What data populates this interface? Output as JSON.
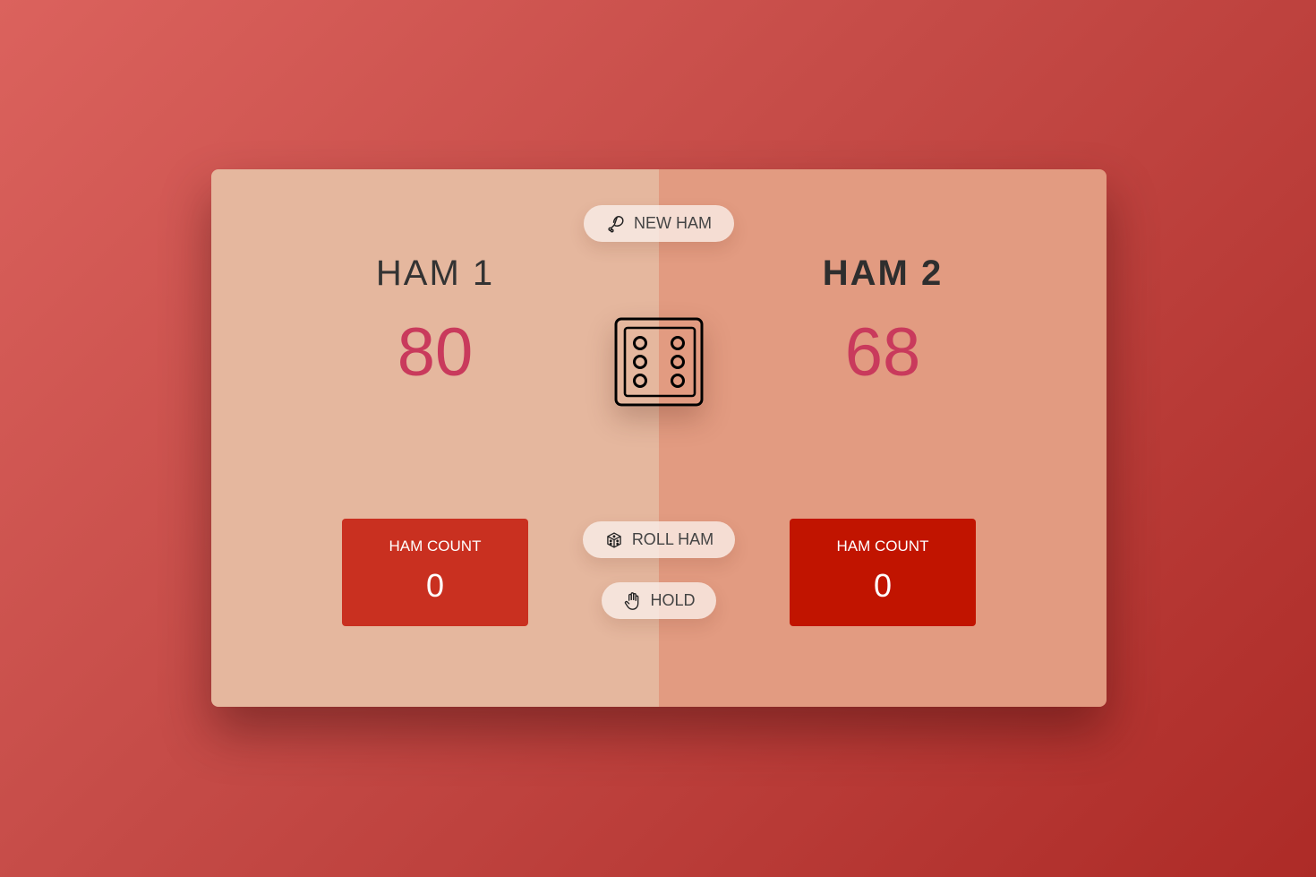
{
  "players": [
    {
      "name": "HAM 1",
      "score": "80",
      "current_label": "HAM COUNT",
      "current_score": "0"
    },
    {
      "name": "HAM 2",
      "score": "68",
      "current_label": "HAM COUNT",
      "current_score": "0"
    }
  ],
  "buttons": {
    "new_label": "NEW HAM",
    "new_icon": "ham-leg-icon",
    "roll_label": "ROLL HAM",
    "roll_icon": "dice-icon",
    "hold_label": "HOLD",
    "hold_icon": "hand-icon"
  },
  "dice": {
    "value": 6,
    "icon": "dice-six-icon"
  },
  "active_player": 2,
  "colors": {
    "background_start": "#db625d",
    "background_end": "#ad2b27",
    "panel_1": "#e5b79e",
    "panel_2": "#e29b81",
    "score": "#c93a5c",
    "current_1": "#c93020",
    "current_2": "#c11400"
  }
}
